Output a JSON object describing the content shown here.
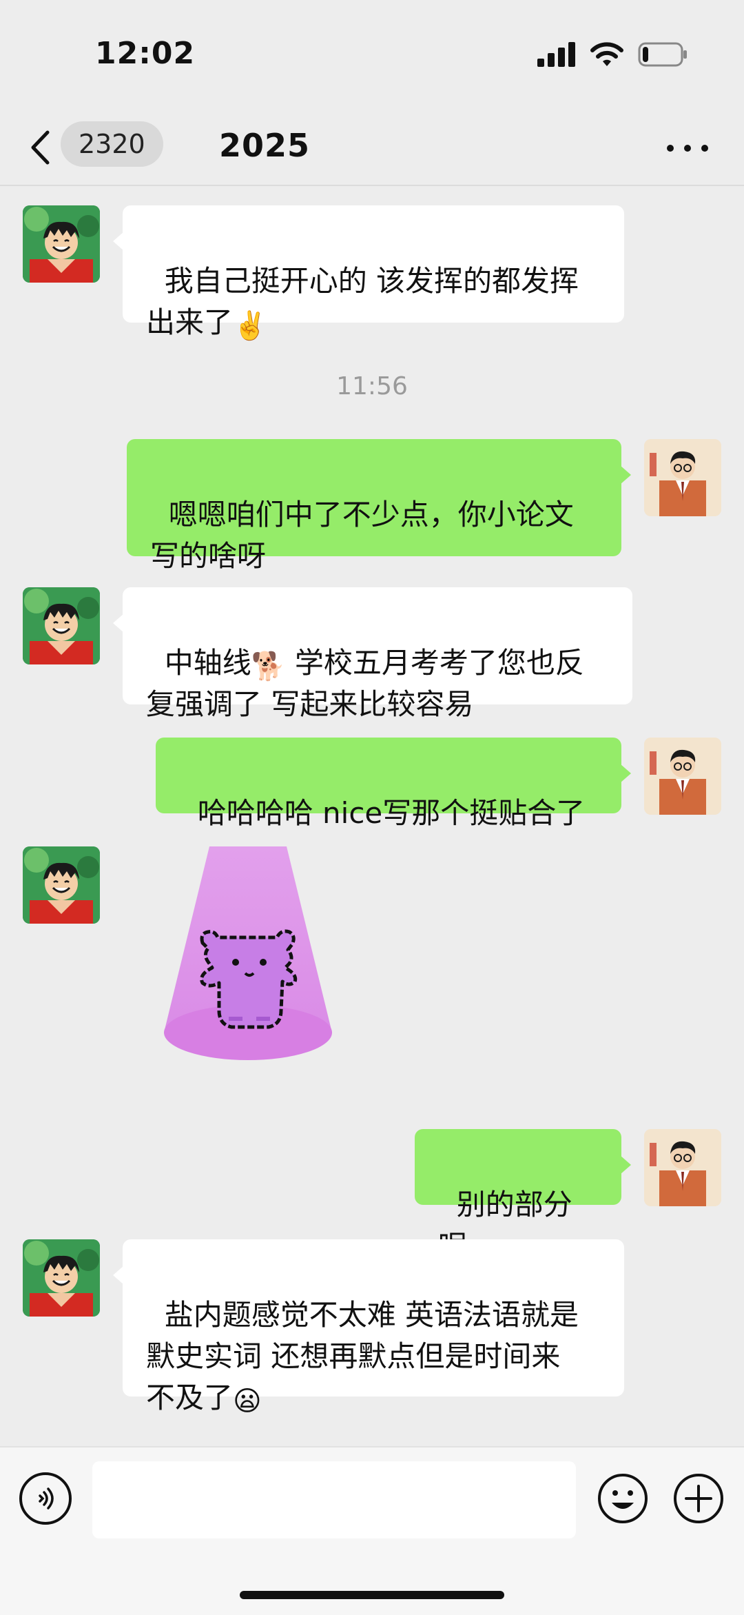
{
  "status_bar": {
    "time": "12:02",
    "icons": [
      "signal-icon",
      "wifi-icon",
      "battery-icon"
    ],
    "battery_level": 0.15
  },
  "header": {
    "unread_count": "2320",
    "title": "2025",
    "back_icon": "chevron-left-icon",
    "more_icon": "more-icon"
  },
  "messages": [
    {
      "side": "in",
      "text": "我自己挺开心的 该发挥的都发挥\n出来了",
      "emoji": "✌️"
    },
    {
      "side": "out",
      "text": "嗯嗯咱们中了不少点，你小论文\n写的啥呀"
    },
    {
      "side": "in",
      "text_before": "中轴线",
      "emoji": "🐕",
      "text_after": " 学校五月考考了您也反\n复强调了 写起来比较容易"
    },
    {
      "side": "out",
      "text": "哈哈哈哈 nice写那个挺贴合了"
    },
    {
      "side": "in",
      "type": "sticker",
      "sticker": "purple-bear-sticker"
    },
    {
      "side": "out",
      "text": "别的部分呢"
    },
    {
      "side": "in",
      "text": "盐内题感觉不太难 英语法语就是\n默史实词 还想再默点但是时间来\n不及了",
      "emoji": "😦"
    }
  ],
  "timestamp": "11:56",
  "input_bar": {
    "placeholder": "",
    "icons": [
      "voice-icon",
      "emoji-icon",
      "plus-icon"
    ]
  },
  "colors": {
    "background": "#ededed",
    "outgoing_bubble": "#95ec69",
    "incoming_bubble": "#ffffff",
    "sticker_glow": "#e8a4ee",
    "bear": "#c979e6"
  }
}
